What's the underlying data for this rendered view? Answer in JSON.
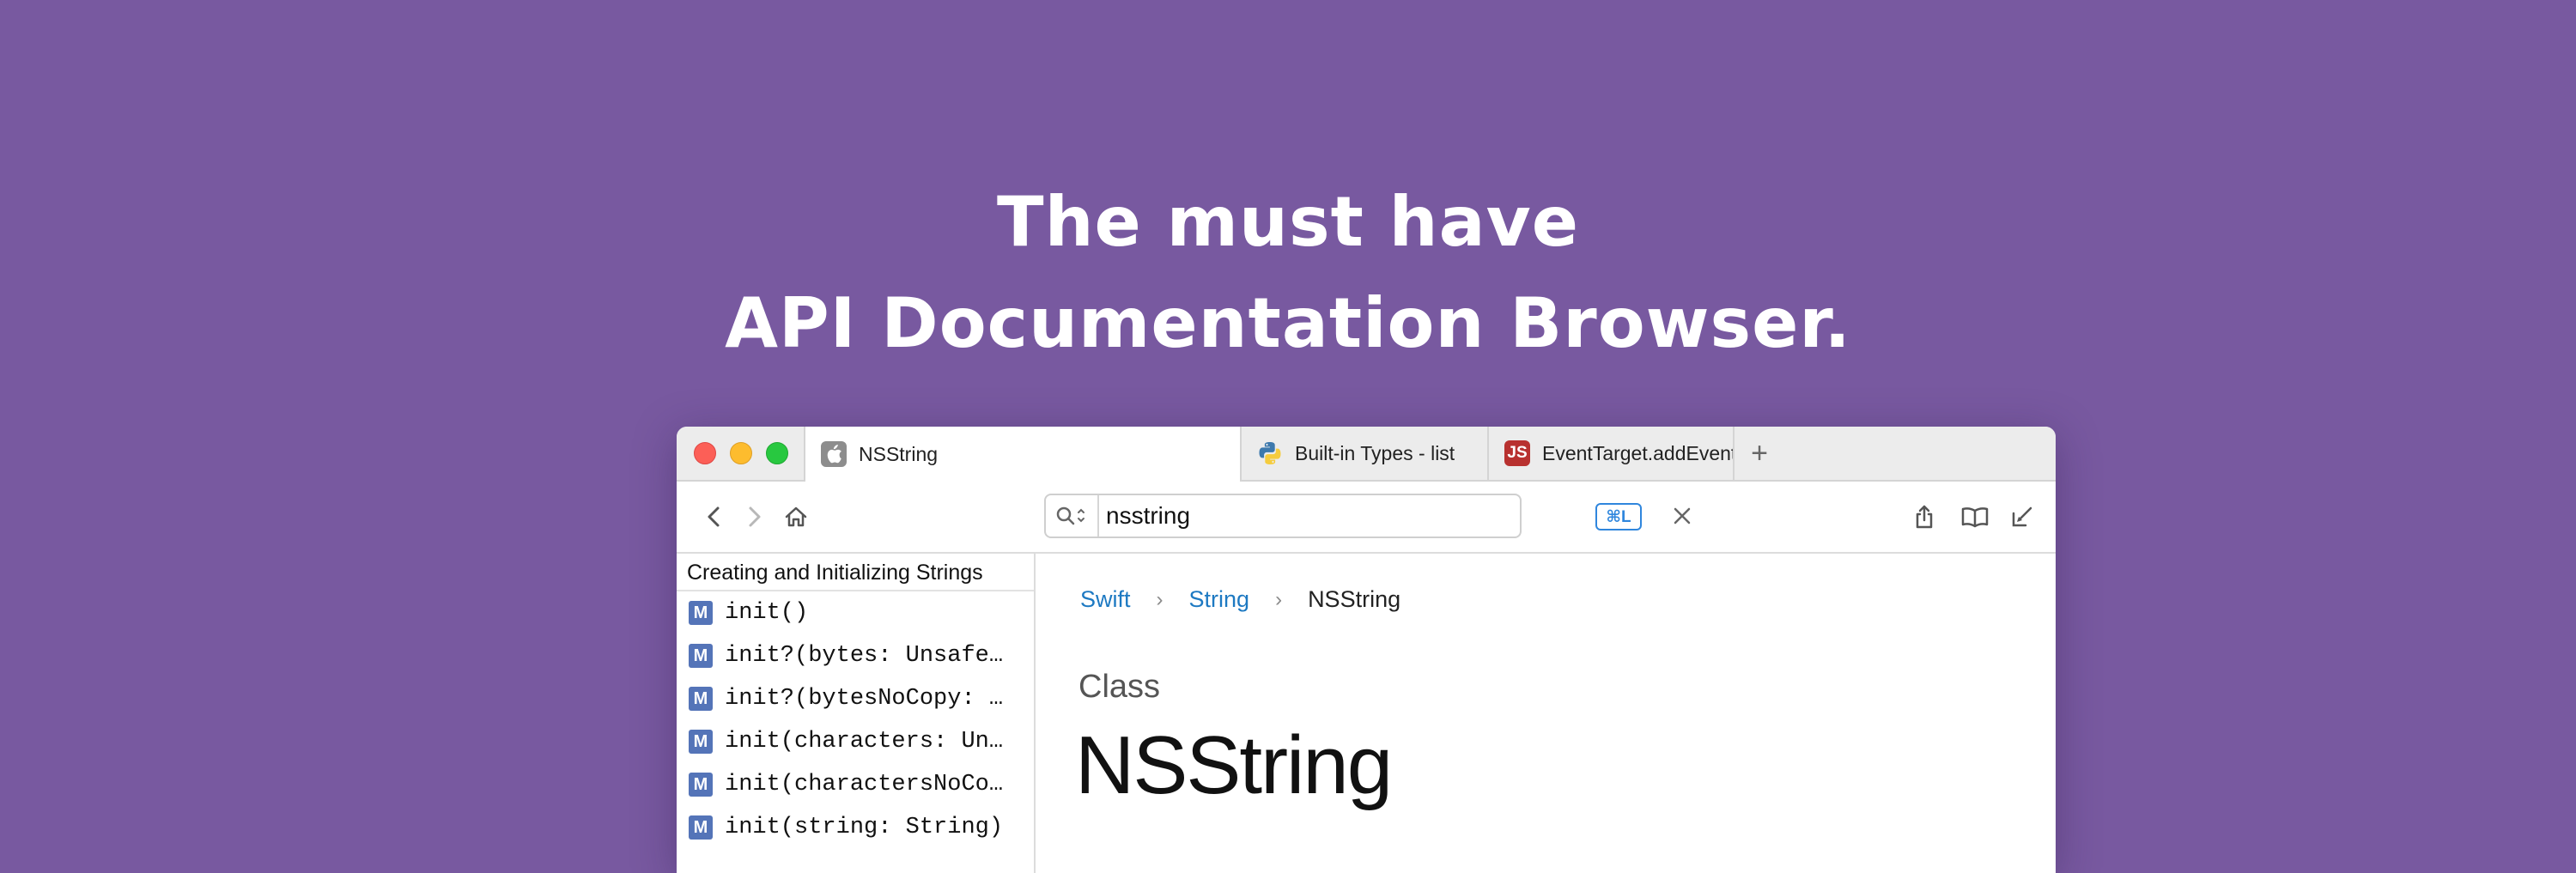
{
  "headline": {
    "line1": "The must have",
    "line2": "API Documentation Browser."
  },
  "tabs": [
    {
      "label": "NSString",
      "icon": "apple-icon",
      "active": true
    },
    {
      "label": "Built-in Types - list",
      "icon": "python-icon",
      "active": false
    },
    {
      "label": "EventTarget.addEventListener",
      "icon": "js-icon",
      "icon_text": "JS",
      "active": false
    }
  ],
  "new_tab_label": "+",
  "search": {
    "value": "nsstring",
    "shortcut": "⌘L"
  },
  "sidebar": {
    "header": "Creating and Initializing Strings",
    "badge": "M",
    "items": [
      "init()",
      "init?(bytes: UnsafeR…",
      "init?(bytesNoCopy: U…",
      "init(characters: Uns…",
      "init(charactersNoCop…",
      "init(string: String)"
    ]
  },
  "content": {
    "breadcrumb": [
      "Swift",
      "String",
      "NSString"
    ],
    "breadcrumb_sep": "›",
    "kind": "Class",
    "title": "NSString"
  },
  "colors": {
    "background": "#7859a0",
    "link": "#1d79c2",
    "badge": "#5474b8",
    "shortcut": "#2f86dd",
    "js": "#b8312f"
  }
}
